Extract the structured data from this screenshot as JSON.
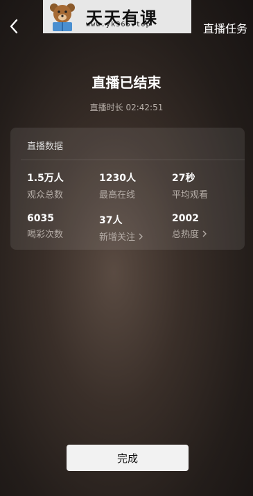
{
  "header": {
    "logo_title": "天天有课",
    "logo_url": "www.yk365.top",
    "task_label": "直播任务"
  },
  "main": {
    "title": "直播已结束",
    "duration": "直播时长 02:42:51"
  },
  "card": {
    "title": "直播数据",
    "stats": [
      {
        "value": "1.5万人",
        "label": "观众总数"
      },
      {
        "value": "1230人",
        "label": "最高在线"
      },
      {
        "value": "27秒",
        "label": "平均观看"
      },
      {
        "value": "6035",
        "label": "喝彩次数"
      },
      {
        "value": "37人",
        "label": "新增关注"
      },
      {
        "value": "2002",
        "label": "总热度"
      }
    ]
  },
  "footer": {
    "done_label": "完成"
  }
}
